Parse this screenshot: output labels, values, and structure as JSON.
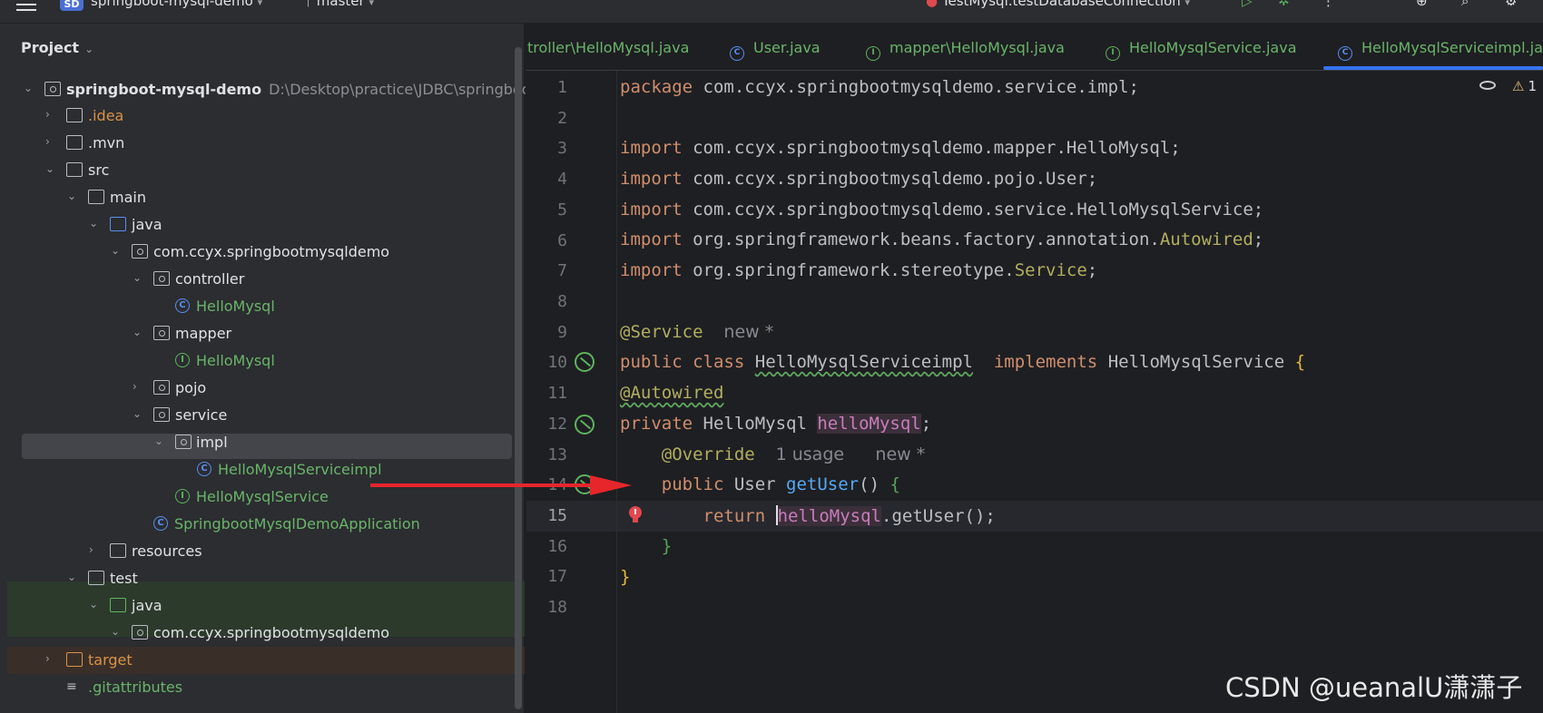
{
  "topbar": {
    "project_badge": "SD",
    "project_name": "springboot-mysql-demo",
    "branch": "master",
    "run_config": "TestMysql.testDatabaseConnection"
  },
  "project_panel": {
    "title": "Project",
    "root_name": "springboot-mysql-demo",
    "root_path": "D:\\Desktop\\practice\\JDBC\\springboot",
    "items": [
      {
        "label": ".idea"
      },
      {
        "label": ".mvn"
      },
      {
        "label": "src"
      },
      {
        "label": "main"
      },
      {
        "label": "java"
      },
      {
        "label": "com.ccyx.springbootmysqldemo"
      },
      {
        "label": "controller"
      },
      {
        "label": "HelloMysql"
      },
      {
        "label": "mapper"
      },
      {
        "label": "HelloMysql"
      },
      {
        "label": "pojo"
      },
      {
        "label": "service"
      },
      {
        "label": "impl"
      },
      {
        "label": "HelloMysqlServiceimpl"
      },
      {
        "label": "HelloMysqlService"
      },
      {
        "label": "SpringbootMysqlDemoApplication"
      },
      {
        "label": "resources"
      },
      {
        "label": "test"
      },
      {
        "label": "java"
      },
      {
        "label": "com.ccyx.springbootmysqldemo"
      },
      {
        "label": "target"
      },
      {
        "label": ".gitattributes"
      }
    ]
  },
  "tabs": [
    {
      "label": "troller\\HelloMysql.java"
    },
    {
      "label": "User.java"
    },
    {
      "label": "mapper\\HelloMysql.java"
    },
    {
      "label": "HelloMysqlService.java"
    },
    {
      "label": "HelloMysqlServiceimpl.java"
    }
  ],
  "editor": {
    "inspection_count": "1",
    "line_numbers": [
      "1",
      "2",
      "3",
      "4",
      "5",
      "6",
      "7",
      "8",
      "9",
      "10",
      "11",
      "12",
      "13",
      "14",
      "15",
      "16",
      "17",
      "18"
    ],
    "code": {
      "l1_kw": "package",
      "l1_rest": " com.ccyx.springbootmysqldemo.service.impl;",
      "import_kw": "import",
      "l3": " com.ccyx.springbootmysqldemo.mapper.HelloMysql;",
      "l4": " com.ccyx.springbootmysqldemo.pojo.User;",
      "l5": " com.ccyx.springbootmysqldemo.service.HelloMysqlService;",
      "l6_a": " org.springframework.beans.factory.annotation.",
      "l6_b": "Autowired",
      "l7_a": " org.springframework.stereotype.",
      "l7_b": "Service",
      "semi": ";",
      "l9_ann": "@Service",
      "l9_hint": "new *",
      "l10_kw1": "public",
      "l10_kw2": "class",
      "l10_name": "HelloMysqlServiceimpl",
      "l10_kw3": "implements",
      "l10_iface": " HelloMysqlService ",
      "brace_open": "{",
      "l11_ann": "@Autowired",
      "l12_kw": "private",
      "l12_type": " HelloMysql ",
      "l12_field": "helloMysql",
      "l13_ann": "@Override",
      "l13_hint1": "1 usage",
      "l13_hint2": "new *",
      "l14_kw": "public",
      "l14_type": " User ",
      "l14_fn": "getUser",
      "l14_parens": "() ",
      "l15_kw": "return",
      "l15_field": "helloMysql",
      "l15_rest": ".getUser();",
      "brace_close": "}"
    }
  },
  "watermark": "CSDN @ueanalU潇潇子"
}
